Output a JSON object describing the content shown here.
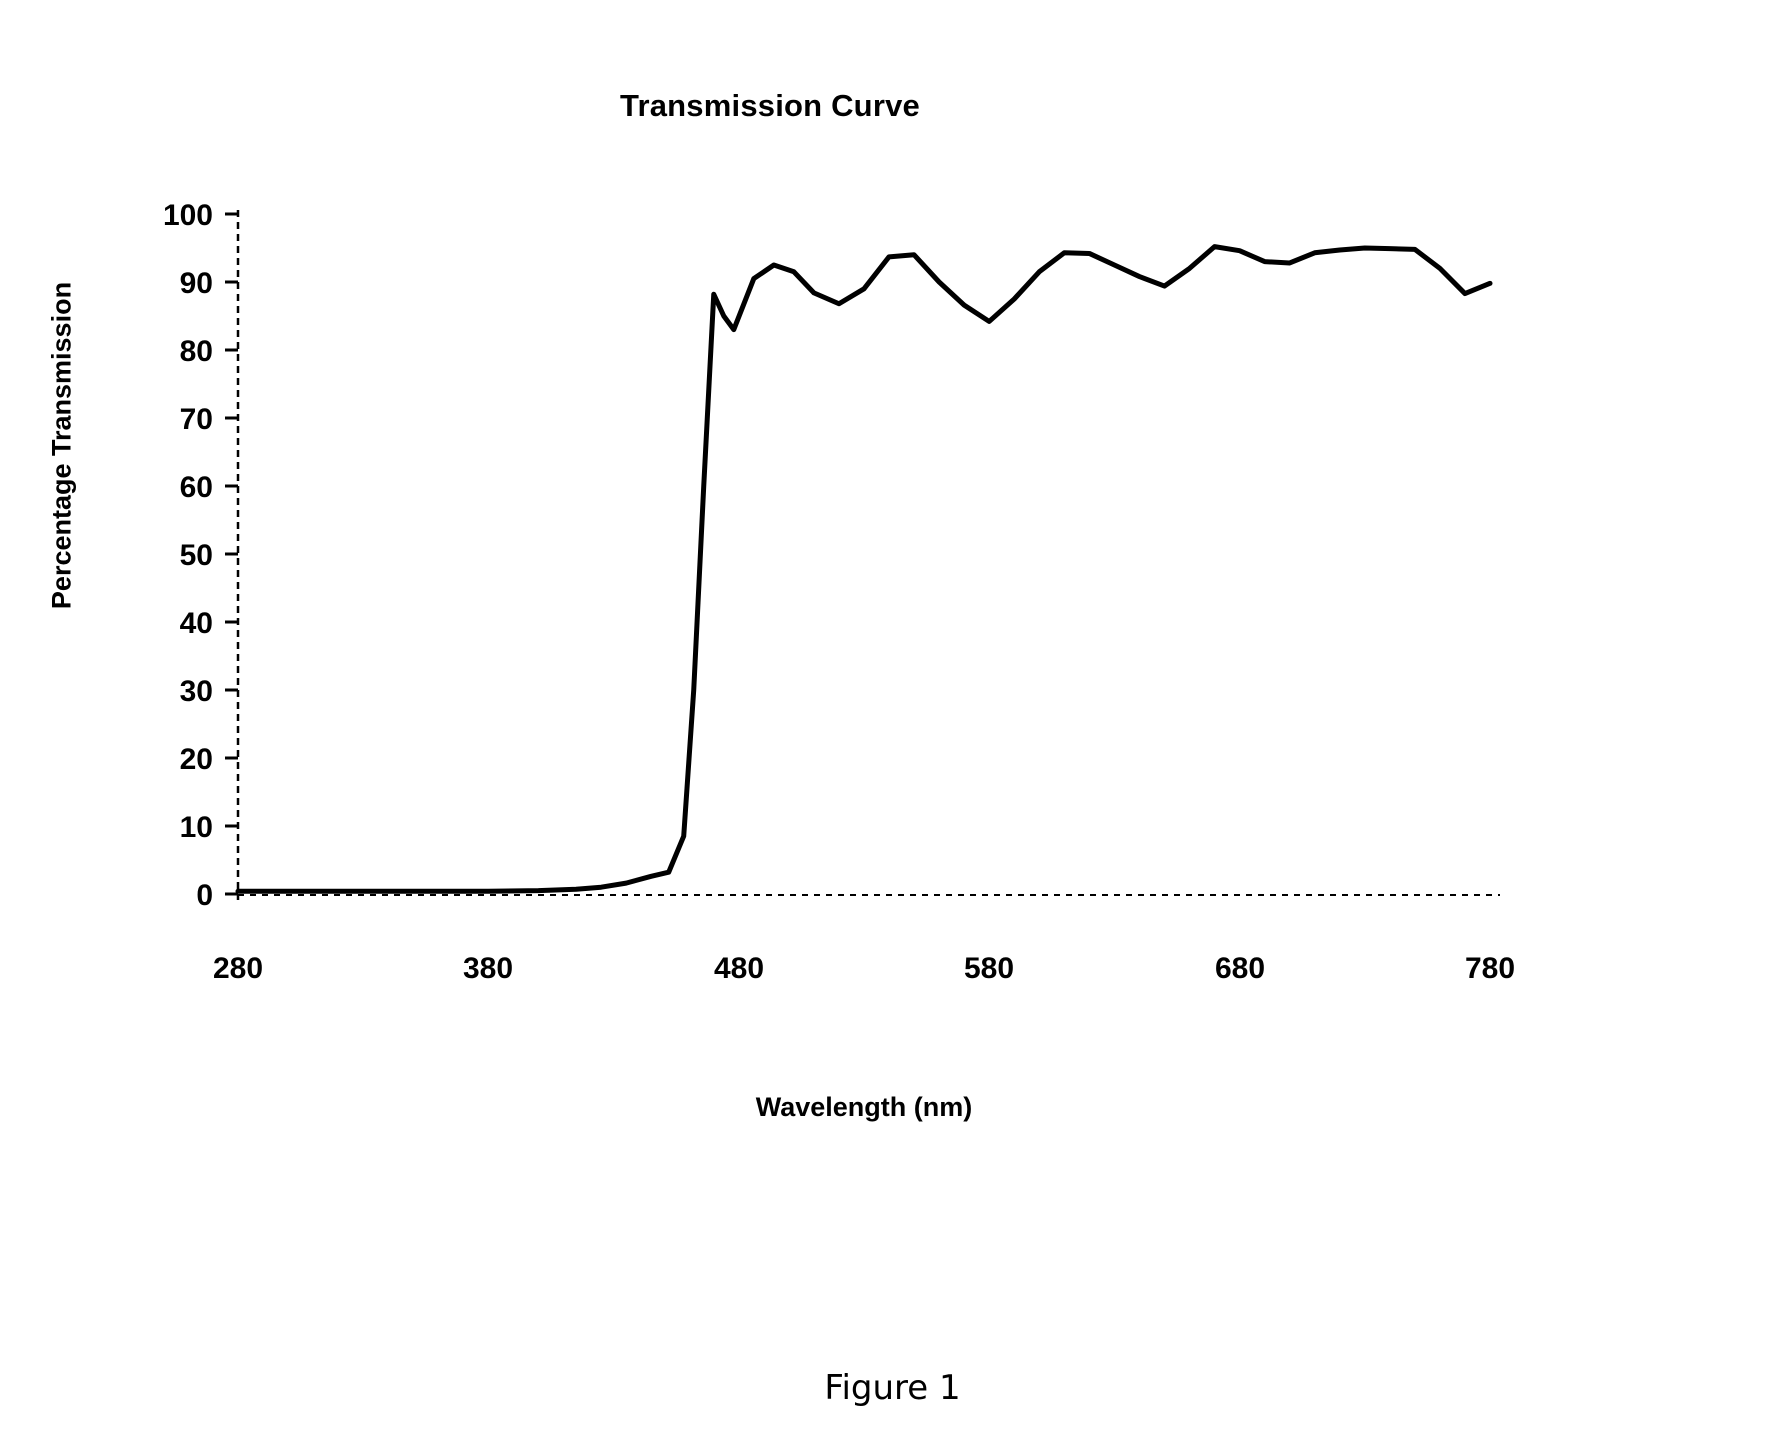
{
  "figure": {
    "caption": "Figure 1"
  },
  "chart_data": {
    "type": "line",
    "title": "Transmission Curve",
    "xlabel": "Wavelength (nm)",
    "ylabel": "Percentage Transmission",
    "xlim": [
      280,
      780
    ],
    "ylim": [
      0,
      100
    ],
    "xticks": [
      280,
      380,
      480,
      580,
      680,
      780
    ],
    "yticks": [
      0,
      10,
      20,
      30,
      40,
      50,
      60,
      70,
      80,
      90,
      100
    ],
    "xtick_labels": [
      "280",
      "380",
      "480",
      "580",
      "680",
      "780"
    ],
    "ytick_labels": [
      "0",
      "10",
      "20",
      "30",
      "40",
      "50",
      "60",
      "70",
      "80",
      "90",
      "100"
    ],
    "grid": false,
    "legend": null,
    "line_color": "#000000",
    "line_width": 5,
    "series": [
      {
        "name": "Transmission",
        "x": [
          280,
          300,
          320,
          340,
          360,
          380,
          400,
          415,
          425,
          435,
          445,
          452,
          458,
          462,
          466,
          470,
          474,
          478,
          486,
          494,
          502,
          510,
          520,
          530,
          540,
          550,
          560,
          570,
          580,
          590,
          600,
          610,
          620,
          630,
          640,
          650,
          660,
          670,
          680,
          690,
          700,
          710,
          720,
          730,
          740,
          750,
          760,
          770,
          780
        ],
        "y": [
          0.4,
          0.4,
          0.4,
          0.4,
          0.4,
          0.4,
          0.5,
          0.7,
          1.0,
          1.6,
          2.6,
          3.2,
          8.5,
          30.0,
          60.0,
          88.2,
          85.0,
          83.0,
          90.5,
          92.5,
          91.5,
          88.4,
          86.8,
          89.0,
          93.7,
          94.0,
          90.0,
          86.6,
          84.2,
          87.5,
          91.5,
          94.3,
          94.2,
          92.5,
          90.8,
          89.4,
          92.0,
          95.2,
          94.6,
          93.0,
          92.8,
          94.3,
          94.7,
          95.0,
          94.9,
          94.8,
          92.0,
          88.3,
          89.8
        ]
      }
    ]
  }
}
